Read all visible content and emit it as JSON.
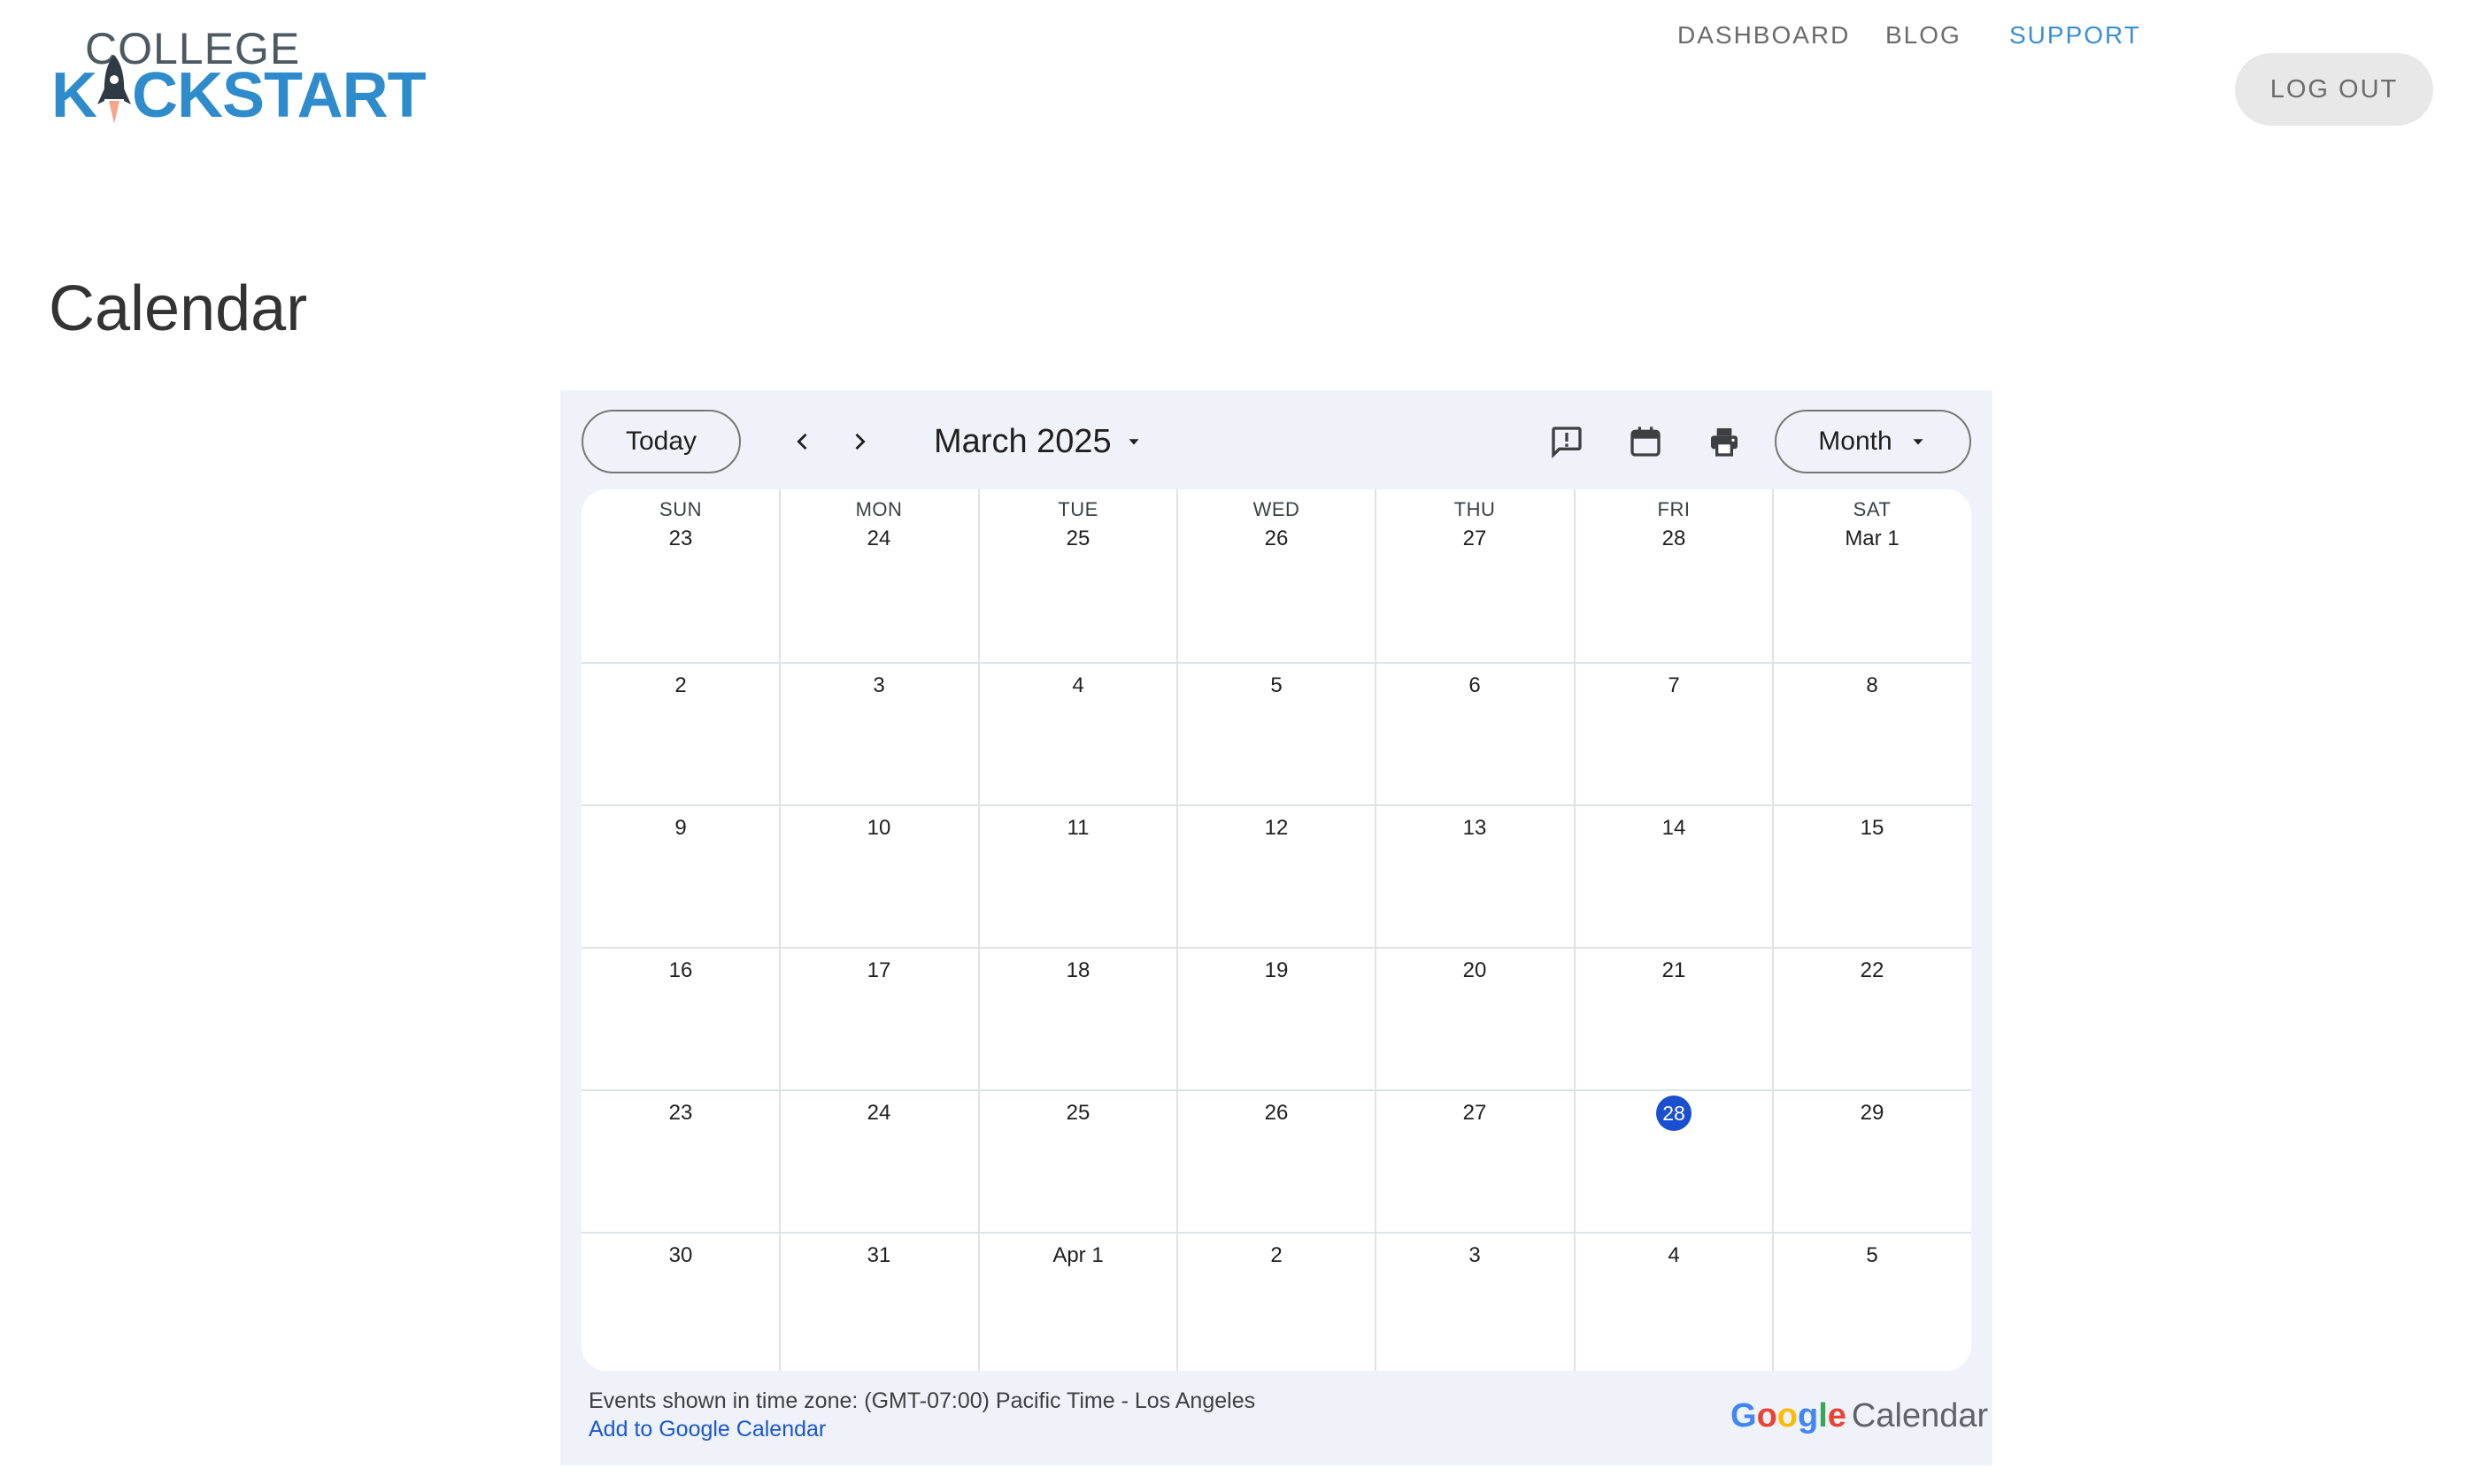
{
  "logo": {
    "line1": "COLLEGE",
    "line2_pre": "K",
    "line2_post": "CKSTART",
    "icon": "rocket-icon"
  },
  "nav": {
    "items": [
      {
        "label": "DASHBOARD",
        "active": false
      },
      {
        "label": "BLOG",
        "active": false
      },
      {
        "label": "SUPPORT",
        "active": true
      }
    ],
    "logout_label": "LOG OUT"
  },
  "page": {
    "title": "Calendar"
  },
  "calendar": {
    "today_button": "Today",
    "prev_icon": "chevron-left-icon",
    "next_icon": "chevron-right-icon",
    "month_label": "March 2025",
    "view_label": "Month",
    "icons": [
      "feedback-icon",
      "calendar-icon",
      "print-icon"
    ],
    "weekdays": [
      "SUN",
      "MON",
      "TUE",
      "WED",
      "THU",
      "FRI",
      "SAT"
    ],
    "weeks": [
      [
        "23",
        "24",
        "25",
        "26",
        "27",
        "28",
        "Mar 1"
      ],
      [
        "2",
        "3",
        "4",
        "5",
        "6",
        "7",
        "8"
      ],
      [
        "9",
        "10",
        "11",
        "12",
        "13",
        "14",
        "15"
      ],
      [
        "16",
        "17",
        "18",
        "19",
        "20",
        "21",
        "22"
      ],
      [
        "23",
        "24",
        "25",
        "26",
        "27",
        "28",
        "29"
      ],
      [
        "30",
        "31",
        "Apr 1",
        "2",
        "3",
        "4",
        "5"
      ]
    ],
    "today_cell": {
      "week": 4,
      "day": 5
    },
    "timezone_text": "Events shown in time zone: (GMT-07:00) Pacific Time - Los Angeles",
    "add_link": "Add to Google Calendar",
    "brand": {
      "google": [
        "G",
        "o",
        "o",
        "g",
        "l",
        "e"
      ],
      "colors": [
        "#4285F4",
        "#EA4335",
        "#FBBC05",
        "#4285F4",
        "#34A853",
        "#EA4335"
      ],
      "suffix": "Calendar"
    }
  },
  "colors": {
    "accent": "#3a8fd2",
    "logo_blue": "#2f8ccc",
    "today_blue": "#1a4fd0",
    "link": "#1a56cf"
  }
}
